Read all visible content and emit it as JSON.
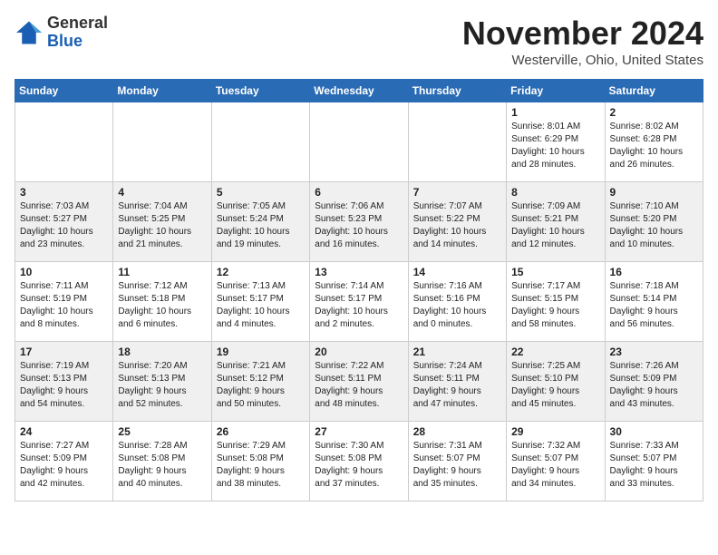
{
  "header": {
    "logo_general": "General",
    "logo_blue": "Blue",
    "month_title": "November 2024",
    "location": "Westerville, Ohio, United States"
  },
  "weekdays": [
    "Sunday",
    "Monday",
    "Tuesday",
    "Wednesday",
    "Thursday",
    "Friday",
    "Saturday"
  ],
  "weeks": [
    [
      {
        "day": "",
        "info": ""
      },
      {
        "day": "",
        "info": ""
      },
      {
        "day": "",
        "info": ""
      },
      {
        "day": "",
        "info": ""
      },
      {
        "day": "",
        "info": ""
      },
      {
        "day": "1",
        "info": "Sunrise: 8:01 AM\nSunset: 6:29 PM\nDaylight: 10 hours\nand 28 minutes."
      },
      {
        "day": "2",
        "info": "Sunrise: 8:02 AM\nSunset: 6:28 PM\nDaylight: 10 hours\nand 26 minutes."
      }
    ],
    [
      {
        "day": "3",
        "info": "Sunrise: 7:03 AM\nSunset: 5:27 PM\nDaylight: 10 hours\nand 23 minutes."
      },
      {
        "day": "4",
        "info": "Sunrise: 7:04 AM\nSunset: 5:25 PM\nDaylight: 10 hours\nand 21 minutes."
      },
      {
        "day": "5",
        "info": "Sunrise: 7:05 AM\nSunset: 5:24 PM\nDaylight: 10 hours\nand 19 minutes."
      },
      {
        "day": "6",
        "info": "Sunrise: 7:06 AM\nSunset: 5:23 PM\nDaylight: 10 hours\nand 16 minutes."
      },
      {
        "day": "7",
        "info": "Sunrise: 7:07 AM\nSunset: 5:22 PM\nDaylight: 10 hours\nand 14 minutes."
      },
      {
        "day": "8",
        "info": "Sunrise: 7:09 AM\nSunset: 5:21 PM\nDaylight: 10 hours\nand 12 minutes."
      },
      {
        "day": "9",
        "info": "Sunrise: 7:10 AM\nSunset: 5:20 PM\nDaylight: 10 hours\nand 10 minutes."
      }
    ],
    [
      {
        "day": "10",
        "info": "Sunrise: 7:11 AM\nSunset: 5:19 PM\nDaylight: 10 hours\nand 8 minutes."
      },
      {
        "day": "11",
        "info": "Sunrise: 7:12 AM\nSunset: 5:18 PM\nDaylight: 10 hours\nand 6 minutes."
      },
      {
        "day": "12",
        "info": "Sunrise: 7:13 AM\nSunset: 5:17 PM\nDaylight: 10 hours\nand 4 minutes."
      },
      {
        "day": "13",
        "info": "Sunrise: 7:14 AM\nSunset: 5:17 PM\nDaylight: 10 hours\nand 2 minutes."
      },
      {
        "day": "14",
        "info": "Sunrise: 7:16 AM\nSunset: 5:16 PM\nDaylight: 10 hours\nand 0 minutes."
      },
      {
        "day": "15",
        "info": "Sunrise: 7:17 AM\nSunset: 5:15 PM\nDaylight: 9 hours\nand 58 minutes."
      },
      {
        "day": "16",
        "info": "Sunrise: 7:18 AM\nSunset: 5:14 PM\nDaylight: 9 hours\nand 56 minutes."
      }
    ],
    [
      {
        "day": "17",
        "info": "Sunrise: 7:19 AM\nSunset: 5:13 PM\nDaylight: 9 hours\nand 54 minutes."
      },
      {
        "day": "18",
        "info": "Sunrise: 7:20 AM\nSunset: 5:13 PM\nDaylight: 9 hours\nand 52 minutes."
      },
      {
        "day": "19",
        "info": "Sunrise: 7:21 AM\nSunset: 5:12 PM\nDaylight: 9 hours\nand 50 minutes."
      },
      {
        "day": "20",
        "info": "Sunrise: 7:22 AM\nSunset: 5:11 PM\nDaylight: 9 hours\nand 48 minutes."
      },
      {
        "day": "21",
        "info": "Sunrise: 7:24 AM\nSunset: 5:11 PM\nDaylight: 9 hours\nand 47 minutes."
      },
      {
        "day": "22",
        "info": "Sunrise: 7:25 AM\nSunset: 5:10 PM\nDaylight: 9 hours\nand 45 minutes."
      },
      {
        "day": "23",
        "info": "Sunrise: 7:26 AM\nSunset: 5:09 PM\nDaylight: 9 hours\nand 43 minutes."
      }
    ],
    [
      {
        "day": "24",
        "info": "Sunrise: 7:27 AM\nSunset: 5:09 PM\nDaylight: 9 hours\nand 42 minutes."
      },
      {
        "day": "25",
        "info": "Sunrise: 7:28 AM\nSunset: 5:08 PM\nDaylight: 9 hours\nand 40 minutes."
      },
      {
        "day": "26",
        "info": "Sunrise: 7:29 AM\nSunset: 5:08 PM\nDaylight: 9 hours\nand 38 minutes."
      },
      {
        "day": "27",
        "info": "Sunrise: 7:30 AM\nSunset: 5:08 PM\nDaylight: 9 hours\nand 37 minutes."
      },
      {
        "day": "28",
        "info": "Sunrise: 7:31 AM\nSunset: 5:07 PM\nDaylight: 9 hours\nand 35 minutes."
      },
      {
        "day": "29",
        "info": "Sunrise: 7:32 AM\nSunset: 5:07 PM\nDaylight: 9 hours\nand 34 minutes."
      },
      {
        "day": "30",
        "info": "Sunrise: 7:33 AM\nSunset: 5:07 PM\nDaylight: 9 hours\nand 33 minutes."
      }
    ]
  ]
}
